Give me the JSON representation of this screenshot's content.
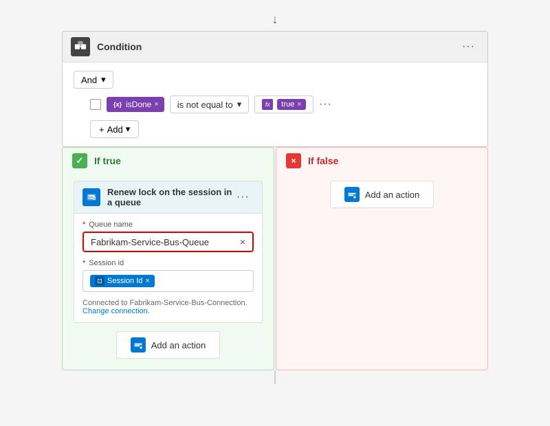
{
  "arrow": "↓",
  "condition": {
    "title": "Condition",
    "and_label": "And",
    "tag_label": "isDone",
    "operator": "is not equal to",
    "value_label": "true",
    "add_label": "Add"
  },
  "if_true": {
    "label": "If true",
    "action": {
      "title": "Renew lock on the session in a queue",
      "queue_field_label": "Queue name",
      "queue_value": "Fabrikam-Service-Bus-Queue",
      "session_field_label": "Session id",
      "session_tag": "Session Id",
      "connection_text": "Connected to Fabrikam-Service-Bus-Connection.",
      "change_connection": "Change connection."
    },
    "add_action_label": "Add an action"
  },
  "if_false": {
    "label": "If false",
    "add_action_label": "Add an action"
  }
}
